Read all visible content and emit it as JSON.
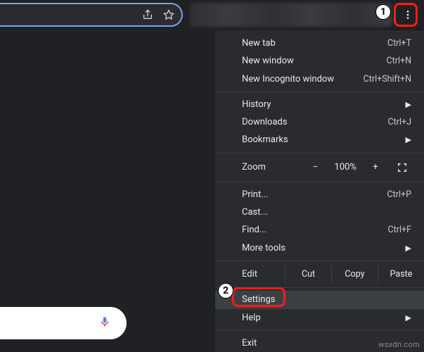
{
  "toolbar": {
    "share_icon": "share-icon",
    "star_icon": "star-icon",
    "kebab_icon": "kebab-icon"
  },
  "menu": {
    "new_tab": {
      "label": "New tab",
      "shortcut": "Ctrl+T"
    },
    "new_window": {
      "label": "New window",
      "shortcut": "Ctrl+N"
    },
    "new_incognito": {
      "label": "New Incognito window",
      "shortcut": "Ctrl+Shift+N"
    },
    "history": {
      "label": "History"
    },
    "downloads": {
      "label": "Downloads",
      "shortcut": "Ctrl+J"
    },
    "bookmarks": {
      "label": "Bookmarks"
    },
    "zoom": {
      "label": "Zoom",
      "minus": "−",
      "value": "100%",
      "plus": "+"
    },
    "print": {
      "label": "Print...",
      "shortcut": "Ctrl+P"
    },
    "cast": {
      "label": "Cast..."
    },
    "find": {
      "label": "Find...",
      "shortcut": "Ctrl+F"
    },
    "more_tools": {
      "label": "More tools"
    },
    "edit": {
      "label": "Edit",
      "cut": "Cut",
      "copy": "Copy",
      "paste": "Paste"
    },
    "settings": {
      "label": "Settings"
    },
    "help": {
      "label": "Help"
    },
    "exit": {
      "label": "Exit"
    }
  },
  "callouts": {
    "step1": "1",
    "step2": "2"
  },
  "watermark": "wsxdn.com"
}
